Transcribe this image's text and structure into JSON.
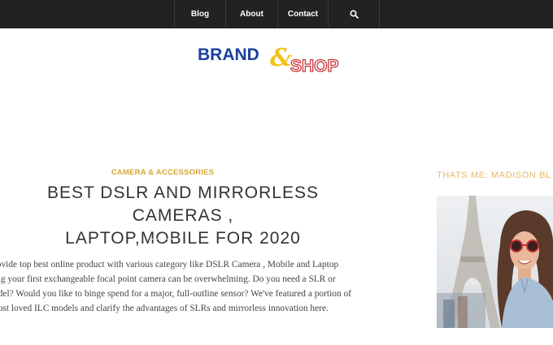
{
  "nav": {
    "items": [
      {
        "label": "Blog"
      },
      {
        "label": "About"
      },
      {
        "label": "Contact"
      }
    ],
    "search_icon": "search-icon"
  },
  "logo": {
    "brand": "BRAND",
    "amp": "&",
    "shop": "SHOP",
    "colors": {
      "brand": "#1d3f9e",
      "amp": "#f3c21b",
      "shop": "#c9363c"
    }
  },
  "post": {
    "category": "CAMERA & ACCESSORIES",
    "title_lines": [
      "BEST DSLR AND MIRRORLESS CAMERAS ,",
      "LAPTOP,MOBILE FOR 2020"
    ],
    "excerpt_lines": [
      "rovide top best online product with various category like DSLR Camera , Mobile and Laptop",
      "ing your first exchangeable focal point camera can be overwhelming. Do you need a SLR or",
      "odel? Would you like to binge spend for a major, full-outline sensor? We've featured a portion of",
      "nost loved ILC models and clarify the advantages of SLRs and mirrorless innovation here."
    ]
  },
  "sidebar": {
    "heading": "THATS ME: MADISON BL"
  },
  "colors": {
    "nav_bg": "#222222",
    "accent": "#d4a838",
    "sidebar_heading": "#e5b96a"
  }
}
